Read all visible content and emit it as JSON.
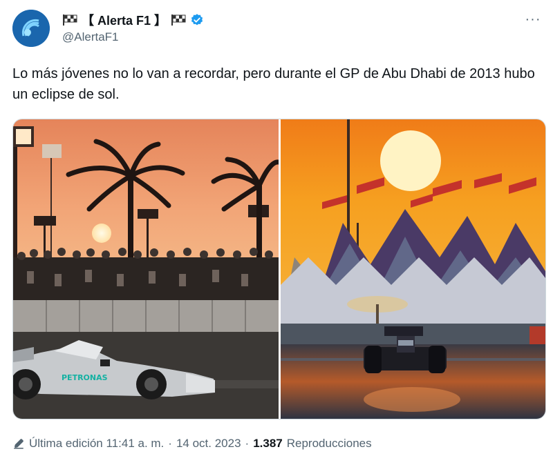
{
  "author": {
    "display_name": "【 Alerta F1 】",
    "handle": "@AlertaF1",
    "verified_color": "#1d9bf0",
    "flag_icon": "chequered-flag-icon"
  },
  "more_label": "···",
  "tweet": {
    "text": "Lo más jóvenes no lo van a recordar, pero durante el GP de Abu Dhabi de 2013 hubo un eclipse de sol."
  },
  "meta": {
    "edit_label": "Última edición 11:41 a. m.",
    "separator1": "·",
    "date": "14 oct. 2023",
    "separator2": "·",
    "views_count": "1.387",
    "views_label": "Reproducciones"
  },
  "colors": {
    "accent": "#1d9bf0",
    "secondary_text": "#536471",
    "primary_text": "#0f1419"
  }
}
